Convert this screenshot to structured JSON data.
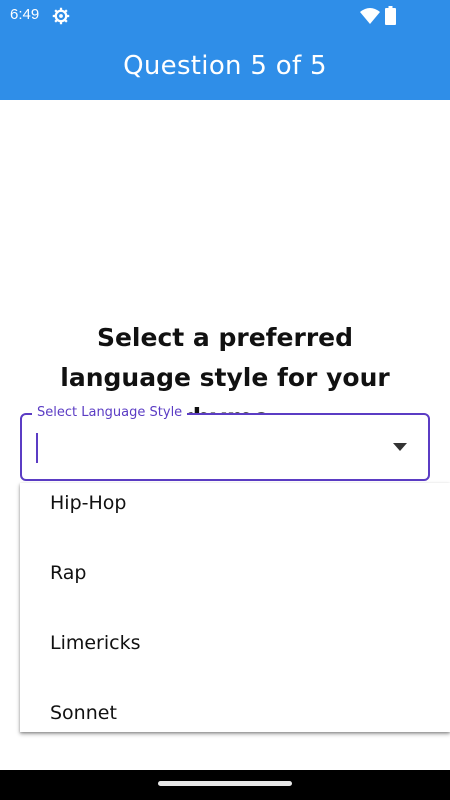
{
  "status_bar": {
    "time": "6:49",
    "icons": [
      "settings-gear-icon",
      "wifi-icon",
      "battery-icon"
    ]
  },
  "app_bar": {
    "title": "Question 5 of 5",
    "color": "#2f8ee8"
  },
  "question": {
    "text": "Select a preferred language style for your rhyme"
  },
  "select_field": {
    "label": "Select Language Style",
    "value": "",
    "accent_color": "#5b3cc4",
    "expanded": true
  },
  "dropdown": {
    "options": [
      "Hip-Hop",
      "Rap",
      "Limericks",
      "Sonnet"
    ]
  }
}
